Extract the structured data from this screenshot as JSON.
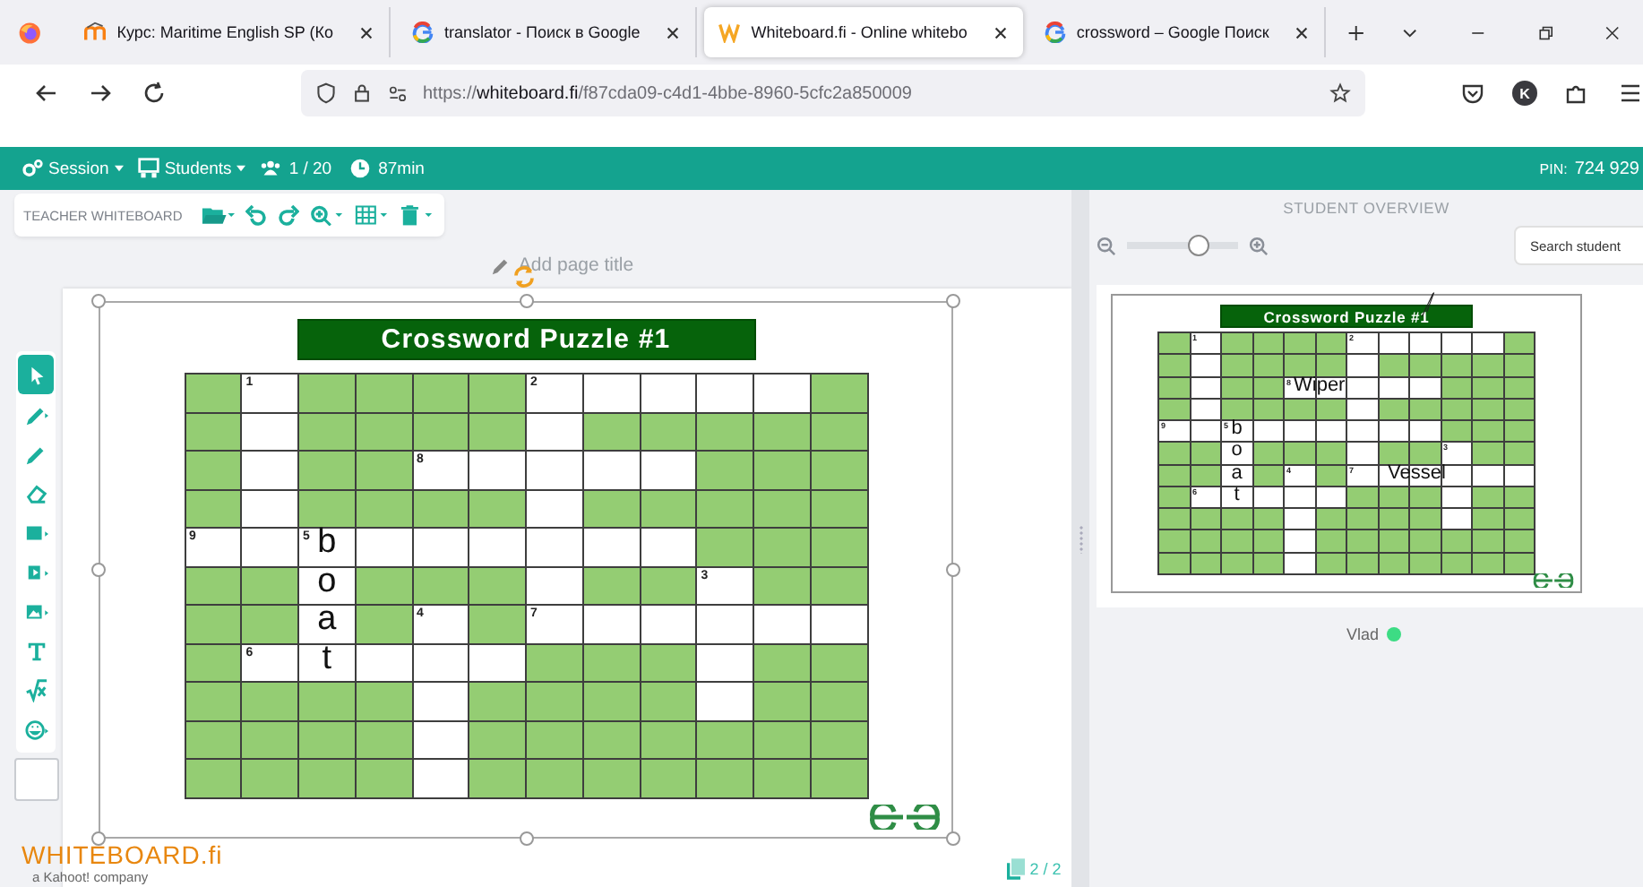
{
  "browser": {
    "tabs": [
      {
        "kind": "moodle",
        "title": "Курс: Maritime English SP (Ко",
        "selected": false
      },
      {
        "kind": "google",
        "title": "translator - Поиск в Google",
        "selected": false
      },
      {
        "kind": "whiteboard",
        "title": "Whiteboard.fi - Online whitebo",
        "selected": true
      },
      {
        "kind": "google",
        "title": "crossword – Google Поиск",
        "selected": false
      }
    ],
    "url": {
      "scheme": "https://",
      "host": "whiteboard.fi",
      "path": "/f87cda09-c4d1-4bbe-8960-5cfc2a850009"
    },
    "profile_initial": "K"
  },
  "app_bar": {
    "session": "Session",
    "students": "Students",
    "student_count": "1 / 20",
    "time": "87min",
    "pin_label": "PIN:",
    "pin": "724 929"
  },
  "teacher_toolbar": {
    "title": "TEACHER WHITEBOARD"
  },
  "page_title": {
    "placeholder": "Add page title"
  },
  "tools": [
    {
      "kind": "select",
      "selected": true
    },
    {
      "kind": "pen",
      "selected": false
    },
    {
      "kind": "marker",
      "selected": false
    },
    {
      "kind": "eraser",
      "selected": false
    },
    {
      "kind": "shape",
      "selected": false
    },
    {
      "kind": "frame",
      "selected": false
    },
    {
      "kind": "image",
      "selected": false
    },
    {
      "kind": "text",
      "selected": false
    },
    {
      "kind": "math",
      "selected": false
    },
    {
      "kind": "emoji",
      "selected": false
    }
  ],
  "board": {
    "banner": "Crossword Puzzle #1",
    "page_counter": "2 / 2",
    "grid": {
      "rows": [
        {
          "cells": [
            {
              "open": false
            },
            {
              "open": true,
              "number": "1"
            },
            {
              "open": false
            },
            {
              "open": false
            },
            {
              "open": false
            },
            {
              "open": false
            },
            {
              "open": true,
              "number": "2"
            },
            {
              "open": true
            },
            {
              "open": true
            },
            {
              "open": true
            },
            {
              "open": true
            },
            {
              "open": false
            }
          ]
        },
        {
          "cells": [
            {
              "open": false
            },
            {
              "open": true
            },
            {
              "open": false
            },
            {
              "open": false
            },
            {
              "open": false
            },
            {
              "open": false
            },
            {
              "open": true
            },
            {
              "open": false
            },
            {
              "open": false
            },
            {
              "open": false
            },
            {
              "open": false
            },
            {
              "open": false
            }
          ]
        },
        {
          "cells": [
            {
              "open": false
            },
            {
              "open": true
            },
            {
              "open": false
            },
            {
              "open": false
            },
            {
              "open": true,
              "number": "8"
            },
            {
              "open": true
            },
            {
              "open": true
            },
            {
              "open": true
            },
            {
              "open": true
            },
            {
              "open": false
            },
            {
              "open": false
            },
            {
              "open": false
            }
          ]
        },
        {
          "cells": [
            {
              "open": false
            },
            {
              "open": true
            },
            {
              "open": false
            },
            {
              "open": false
            },
            {
              "open": false
            },
            {
              "open": false
            },
            {
              "open": true
            },
            {
              "open": false
            },
            {
              "open": false
            },
            {
              "open": false
            },
            {
              "open": false
            },
            {
              "open": false
            }
          ]
        },
        {
          "cells": [
            {
              "open": true,
              "number": "9"
            },
            {
              "open": true
            },
            {
              "open": true,
              "number": "5",
              "letter": "b"
            },
            {
              "open": true
            },
            {
              "open": true
            },
            {
              "open": true
            },
            {
              "open": true
            },
            {
              "open": true
            },
            {
              "open": true
            },
            {
              "open": false
            },
            {
              "open": false
            },
            {
              "open": false
            }
          ]
        },
        {
          "cells": [
            {
              "open": false
            },
            {
              "open": false
            },
            {
              "open": true,
              "letter": "o"
            },
            {
              "open": false
            },
            {
              "open": false
            },
            {
              "open": false
            },
            {
              "open": true
            },
            {
              "open": false
            },
            {
              "open": false
            },
            {
              "open": true,
              "number": "3"
            },
            {
              "open": false
            },
            {
              "open": false
            }
          ]
        },
        {
          "cells": [
            {
              "open": false
            },
            {
              "open": false
            },
            {
              "open": true,
              "letter": "a"
            },
            {
              "open": false
            },
            {
              "open": true,
              "number": "4"
            },
            {
              "open": false
            },
            {
              "open": true,
              "number": "7"
            },
            {
              "open": true
            },
            {
              "open": true
            },
            {
              "open": true
            },
            {
              "open": true
            },
            {
              "open": true
            }
          ]
        },
        {
          "cells": [
            {
              "open": false
            },
            {
              "open": true,
              "number": "6"
            },
            {
              "open": true,
              "letter": "t"
            },
            {
              "open": true
            },
            {
              "open": true
            },
            {
              "open": true
            },
            {
              "open": false
            },
            {
              "open": false
            },
            {
              "open": false
            },
            {
              "open": true
            },
            {
              "open": false
            },
            {
              "open": false
            }
          ]
        },
        {
          "cells": [
            {
              "open": false
            },
            {
              "open": false
            },
            {
              "open": false
            },
            {
              "open": false
            },
            {
              "open": true
            },
            {
              "open": false
            },
            {
              "open": false
            },
            {
              "open": false
            },
            {
              "open": false
            },
            {
              "open": true
            },
            {
              "open": false
            },
            {
              "open": false
            }
          ]
        },
        {
          "cells": [
            {
              "open": false
            },
            {
              "open": false
            },
            {
              "open": false
            },
            {
              "open": false
            },
            {
              "open": true
            },
            {
              "open": false
            },
            {
              "open": false
            },
            {
              "open": false
            },
            {
              "open": false
            },
            {
              "open": false
            },
            {
              "open": false
            },
            {
              "open": false
            }
          ]
        },
        {
          "cells": [
            {
              "open": false
            },
            {
              "open": false
            },
            {
              "open": false
            },
            {
              "open": false
            },
            {
              "open": true
            },
            {
              "open": false
            },
            {
              "open": false
            },
            {
              "open": false
            },
            {
              "open": false
            },
            {
              "open": false
            },
            {
              "open": false
            },
            {
              "open": false
            }
          ]
        }
      ]
    }
  },
  "brand": {
    "logo": "WHITEBOARD.fi",
    "tagline": "a Kahoot! company"
  },
  "student_overview": {
    "title": "STUDENT OVERVIEW",
    "zoom": {
      "level": 0.65
    },
    "search": {
      "placeholder": "Search student"
    },
    "students": [
      {
        "name": "Vlad",
        "online": true,
        "banner": "Crossword Puzzle #1",
        "grid": {
          "rows": [
            {
              "cells": [
                {
                  "open": false
                },
                {
                  "open": true,
                  "number": "1"
                },
                {
                  "open": false
                },
                {
                  "open": false
                },
                {
                  "open": false
                },
                {
                  "open": false
                },
                {
                  "open": true,
                  "number": "2"
                },
                {
                  "open": true
                },
                {
                  "open": true
                },
                {
                  "open": true
                },
                {
                  "open": true
                },
                {
                  "open": false
                }
              ]
            },
            {
              "cells": [
                {
                  "open": false
                },
                {
                  "open": true
                },
                {
                  "open": false
                },
                {
                  "open": false
                },
                {
                  "open": false
                },
                {
                  "open": false
                },
                {
                  "open": true
                },
                {
                  "open": false
                },
                {
                  "open": false
                },
                {
                  "open": false
                },
                {
                  "open": false
                },
                {
                  "open": false
                }
              ]
            },
            {
              "cells": [
                {
                  "open": false
                },
                {
                  "open": true
                },
                {
                  "open": false
                },
                {
                  "open": false
                },
                {
                  "open": true,
                  "number": "8",
                  "overlay": "Wiper"
                },
                {
                  "open": true
                },
                {
                  "open": true
                },
                {
                  "open": true
                },
                {
                  "open": true
                },
                {
                  "open": false
                },
                {
                  "open": false
                },
                {
                  "open": false
                }
              ]
            },
            {
              "cells": [
                {
                  "open": false
                },
                {
                  "open": true
                },
                {
                  "open": false
                },
                {
                  "open": false
                },
                {
                  "open": false
                },
                {
                  "open": false
                },
                {
                  "open": true
                },
                {
                  "open": false
                },
                {
                  "open": false
                },
                {
                  "open": false
                },
                {
                  "open": false
                },
                {
                  "open": false
                }
              ]
            },
            {
              "cells": [
                {
                  "open": true,
                  "number": "9"
                },
                {
                  "open": true
                },
                {
                  "open": true,
                  "number": "5",
                  "letter": "b"
                },
                {
                  "open": true
                },
                {
                  "open": true
                },
                {
                  "open": true
                },
                {
                  "open": true
                },
                {
                  "open": true
                },
                {
                  "open": true
                },
                {
                  "open": false
                },
                {
                  "open": false
                },
                {
                  "open": false
                }
              ]
            },
            {
              "cells": [
                {
                  "open": false
                },
                {
                  "open": false
                },
                {
                  "open": true,
                  "letter": "o"
                },
                {
                  "open": false
                },
                {
                  "open": false
                },
                {
                  "open": false
                },
                {
                  "open": true
                },
                {
                  "open": false
                },
                {
                  "open": false
                },
                {
                  "open": true,
                  "number": "3"
                },
                {
                  "open": false
                },
                {
                  "open": false
                }
              ]
            },
            {
              "cells": [
                {
                  "open": false
                },
                {
                  "open": false
                },
                {
                  "open": true,
                  "letter": "a"
                },
                {
                  "open": false
                },
                {
                  "open": true,
                  "number": "4"
                },
                {
                  "open": false
                },
                {
                  "open": true,
                  "number": "7"
                },
                {
                  "open": true,
                  "overlay": "Vessel"
                },
                {
                  "open": true
                },
                {
                  "open": true
                },
                {
                  "open": true
                },
                {
                  "open": true
                }
              ]
            },
            {
              "cells": [
                {
                  "open": false
                },
                {
                  "open": true,
                  "number": "6"
                },
                {
                  "open": true,
                  "letter": "t"
                },
                {
                  "open": true
                },
                {
                  "open": true
                },
                {
                  "open": true
                },
                {
                  "open": false
                },
                {
                  "open": false
                },
                {
                  "open": false
                },
                {
                  "open": true
                },
                {
                  "open": false
                },
                {
                  "open": false
                }
              ]
            },
            {
              "cells": [
                {
                  "open": false
                },
                {
                  "open": false
                },
                {
                  "open": false
                },
                {
                  "open": false
                },
                {
                  "open": true
                },
                {
                  "open": false
                },
                {
                  "open": false
                },
                {
                  "open": false
                },
                {
                  "open": false
                },
                {
                  "open": true
                },
                {
                  "open": false
                },
                {
                  "open": false
                }
              ]
            },
            {
              "cells": [
                {
                  "open": false
                },
                {
                  "open": false
                },
                {
                  "open": false
                },
                {
                  "open": false
                },
                {
                  "open": true
                },
                {
                  "open": false
                },
                {
                  "open": false
                },
                {
                  "open": false
                },
                {
                  "open": false
                },
                {
                  "open": false
                },
                {
                  "open": false
                },
                {
                  "open": false
                }
              ]
            },
            {
              "cells": [
                {
                  "open": false
                },
                {
                  "open": false
                },
                {
                  "open": false
                },
                {
                  "open": false
                },
                {
                  "open": true
                },
                {
                  "open": false
                },
                {
                  "open": false
                },
                {
                  "open": false
                },
                {
                  "open": false
                },
                {
                  "open": false
                },
                {
                  "open": false
                },
                {
                  "open": false
                }
              ]
            }
          ]
        }
      }
    ]
  }
}
